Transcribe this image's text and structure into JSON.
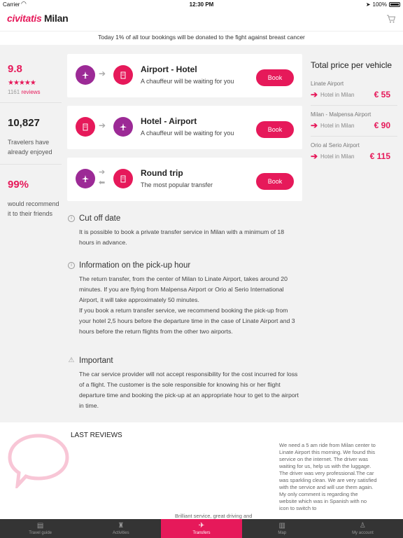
{
  "status_bar": {
    "carrier": "Carrier",
    "time": "12:30 PM",
    "battery": "100%"
  },
  "header": {
    "brand": "civitatis",
    "city": "Milan"
  },
  "banner": "Today 1% of all tour bookings will be donated to the fight against breast cancer",
  "stats": {
    "rating": "9.8",
    "stars": "★★★★★",
    "reviews_count": "1161",
    "reviews_label": "reviews",
    "travelers": "10,827",
    "travelers_text": "Travelers have already enjoyed",
    "recommend": "99%",
    "recommend_text": "would recommend it to their friends"
  },
  "transfers": [
    {
      "title": "Airport - Hotel",
      "desc": "A chauffeur will be waiting for you",
      "book": "Book",
      "icons": [
        "plane-icon",
        "hotel-icon"
      ]
    },
    {
      "title": "Hotel - Airport",
      "desc": "A chauffeur will be waiting for you",
      "book": "Book",
      "icons": [
        "hotel-icon",
        "plane-icon"
      ]
    },
    {
      "title": "Round trip",
      "desc": "The most popular transfer",
      "book": "Book",
      "icons": [
        "plane-icon",
        "hotel-icon"
      ]
    }
  ],
  "price_panel": {
    "title": "Total price per vehicle",
    "rows": [
      {
        "from": "Linate Airport",
        "to": "Hotel in Milan",
        "price": "€ 55"
      },
      {
        "from": "Milan - Malpensa Airport",
        "to": "Hotel in Milan",
        "price": "€ 90"
      },
      {
        "from": "Orio al Serio Airport",
        "to": "Hotel in Milan",
        "price": "€ 115"
      }
    ]
  },
  "sections": {
    "cutoff": {
      "title": "Cut off date",
      "body": "It is possible to book a private transfer service in Milan with a minimum of 18 hours in advance."
    },
    "pickup": {
      "title": "Information on the pick-up hour",
      "body1": "The return transfer, from the center of Milan to Linate Airport, takes around 20 minutes. If you are flying from Malpensa Airport or Orio al Serio International Airport, it will take approximately 50 minutes.",
      "body2": "If you book a return transfer service, we recommend booking the pick-up from your hotel 2,5 hours before the departure time in the case of Linate Airport and 3 hours before the return flights from the other two airports."
    },
    "important": {
      "title": "Important",
      "body": "The car service provider will not accept responsibility for the cost incurred for loss of a flight. The customer is the sole responsible for knowing his or her flight departure time and booking the pick-up at an appropriate hour to get to the airport in time."
    }
  },
  "reviews": {
    "title": "LAST REVIEWS",
    "review1": "We need a 5 am ride from Milan center to Linate Airport this morning. We found this service on the internet. The driver was waiting for us, help us with the luggage. The driver was very professional.The car was sparkling clean. We are very satisfied with the service and will use them again. My only comment is regarding the website which was in Spanish with no icon to switch to",
    "review2": "Brilliant service, great driving and"
  },
  "tabbar": [
    {
      "label": "Travel guide",
      "icon": "map-book-icon"
    },
    {
      "label": "Activities",
      "icon": "activities-icon"
    },
    {
      "label": "Transfers",
      "icon": "plane-icon"
    },
    {
      "label": "Map",
      "icon": "map-icon"
    },
    {
      "label": "My account",
      "icon": "person-icon"
    }
  ],
  "colors": {
    "accent": "#e6195a",
    "purple": "#9c2a96",
    "tabbar": "#343434"
  }
}
